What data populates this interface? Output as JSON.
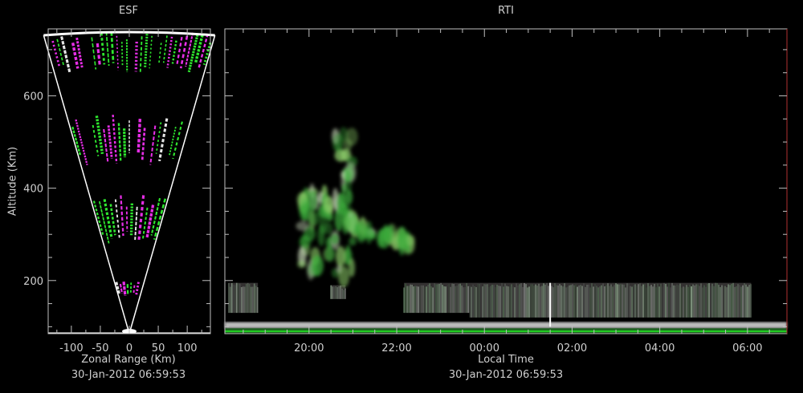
{
  "esf": {
    "title": "ESF",
    "xlabel": "Zonal Range (Km)",
    "ylabel": "Altitude (Km)",
    "timestamp": "30-Jan-2012 06:59:53"
  },
  "rti": {
    "title": "RTI",
    "xlabel": "Local Time",
    "timestamp": "30-Jan-2012 06:59:53"
  },
  "colors": {
    "background": "#000000",
    "axis": "#bfbfbf",
    "text": "#cfcfcf",
    "echo_green": "#33ff33",
    "echo_magenta": "#ff33ff",
    "baseline": "#22cc22"
  },
  "chart_data": [
    {
      "type": "heatmap",
      "title": "ESF",
      "xlabel": "Zonal Range (Km)",
      "ylabel": "Altitude (Km)",
      "xlim": [
        -140,
        140
      ],
      "ylim": [
        85,
        745
      ],
      "x_ticks": [
        -100,
        -50,
        0,
        50,
        100
      ],
      "x_tick_labels": [
        "-100",
        "-50",
        "0",
        "50",
        "100"
      ],
      "y_ticks": [
        200,
        400,
        600
      ],
      "y_tick_labels": [
        "200",
        "400",
        "600"
      ],
      "echo_bands_km": [
        [
          165,
          200
        ],
        [
          280,
          385
        ],
        [
          450,
          560
        ],
        [
          650,
          740
        ]
      ],
      "fan_half_angle_deg": 16,
      "fan_apex_altitude_km": 85
    },
    {
      "type": "heatmap",
      "title": "RTI",
      "xlabel": "Local Time",
      "ylim": [
        85,
        745
      ],
      "y_ticks": [
        200,
        400,
        600
      ],
      "x_ticks": [
        "20:00",
        "22:00",
        "00:00",
        "02:00",
        "04:00",
        "06:00"
      ],
      "x_tick_hours": [
        20,
        22,
        24,
        26,
        28,
        30
      ],
      "xlim_hours": [
        18.08,
        30.9
      ],
      "plumes": [
        {
          "start": "19:50",
          "end": "20:30",
          "alt_range_km": [
            220,
            400
          ]
        },
        {
          "start": "20:35",
          "end": "21:00",
          "alt_range_km": [
            200,
            520
          ]
        },
        {
          "start": "20:50",
          "end": "22:20",
          "alt_range_km": [
            260,
            330
          ]
        }
      ],
      "bottomside_layers": [
        {
          "start": "18:10",
          "end": "18:50",
          "alt_range_km": [
            130,
            195
          ]
        },
        {
          "start": "20:30",
          "end": "20:50",
          "alt_range_km": [
            160,
            190
          ]
        },
        {
          "start": "22:10",
          "end": "23:40",
          "alt_range_km": [
            130,
            195
          ]
        },
        {
          "start": "23:40",
          "end": "06:05",
          "alt_range_km": [
            120,
            195
          ]
        }
      ],
      "lower_band_km": [
        100,
        110
      ]
    }
  ]
}
